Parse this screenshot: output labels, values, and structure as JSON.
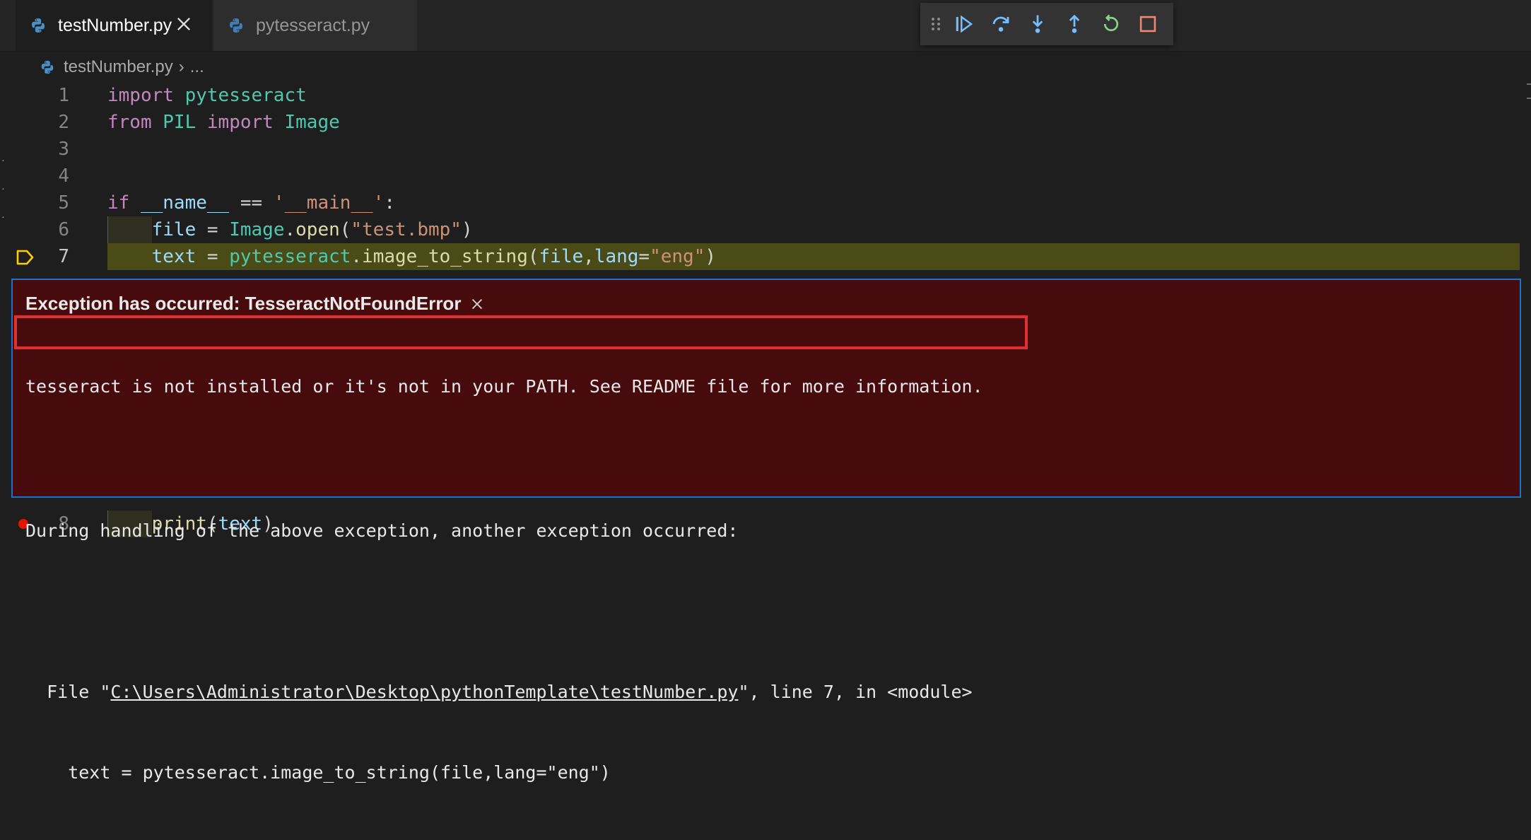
{
  "tabs": [
    {
      "label": "testNumber.py",
      "active": true,
      "icon": "python-icon"
    },
    {
      "label": "pytesseract.py",
      "active": false,
      "icon": "python-icon"
    }
  ],
  "breadcrumb": {
    "file": "testNumber.py",
    "sep": "›",
    "rest": "..."
  },
  "debug_toolbar": [
    "grip-icon",
    "continue-icon",
    "step-over-icon",
    "step-into-icon",
    "step-out-icon",
    "restart-icon",
    "stop-icon"
  ],
  "lines": {
    "l1": {
      "num": "1",
      "t1": "import",
      "t2": " pytesseract"
    },
    "l2": {
      "num": "2",
      "t1": "from",
      "t2": " PIL ",
      "t3": "import",
      "t4": " Image"
    },
    "l3": {
      "num": "3"
    },
    "l4": {
      "num": "4"
    },
    "l5": {
      "num": "5",
      "t1": "if",
      "t2": " __name__",
      "t3": " == ",
      "t4": "'__main__'",
      "t5": ":"
    },
    "l6": {
      "num": "6",
      "t1": "    file",
      "t2": " = ",
      "t3": "Image",
      "t4": ".",
      "t5": "open",
      "t6": "(",
      "t7": "\"test.bmp\"",
      "t8": ")"
    },
    "l7": {
      "num": "7",
      "t1": "    text",
      "t2": " = ",
      "t3": "pytesseract",
      "t4": ".",
      "t5": "image_to_string",
      "t6": "(",
      "t7": "file",
      "t8": ",",
      "t9": "lang",
      "t10": "=",
      "t11": "\"eng\"",
      "t12": ")"
    },
    "l8": {
      "num": "8",
      "t1": "    ",
      "t2": "print",
      "t3": "(",
      "t4": "text",
      "t5": ")"
    }
  },
  "exception": {
    "title": "Exception has occurred: TesseractNotFoundError",
    "message": "tesseract is not installed or it's not in your PATH. See README file for more information.",
    "during": "During handling of the above exception, another exception occurred:",
    "file_prefix": "  File \"",
    "file_path": "C:\\Users\\Administrator\\Desktop\\pythonTemplate\\testNumber.py",
    "file_suffix": "\", line 7, in <module>",
    "code_line": "    text = pytesseract.image_to_string(file,lang=\"eng\")"
  },
  "colors": {
    "accent": "#1a73c9",
    "error_bg": "#470b0e",
    "highlight": "#4b4b18",
    "breakpoint": "#e51400"
  }
}
